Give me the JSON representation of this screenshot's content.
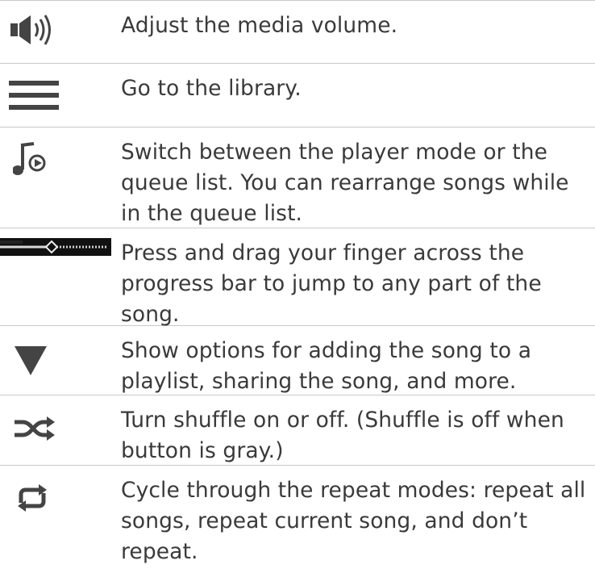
{
  "rows": [
    {
      "icon": "volume-icon",
      "text": "Adjust the media volume."
    },
    {
      "icon": "library-menu-icon",
      "text": "Go to the library."
    },
    {
      "icon": "queue-music-icon",
      "text": "Switch between the player mode or the queue list. You can rearrange songs while in the queue list."
    },
    {
      "icon": "progress-bar-icon",
      "text": "Press and drag your finger across the progress bar to jump to any part of the song."
    },
    {
      "icon": "dropdown-arrow-icon",
      "text": "Show options for adding the song to a playlist, sharing the song, and more."
    },
    {
      "icon": "shuffle-icon",
      "text": "Turn shuffle on or off. (Shuffle is off when button is gray.)"
    },
    {
      "icon": "repeat-icon",
      "text": "Cycle through the repeat modes: repeat all songs, repeat current song, and don’t repeat."
    }
  ],
  "colors": {
    "text": "#3a3a3a",
    "icon": "#444444",
    "divider": "#c9c9c9"
  }
}
